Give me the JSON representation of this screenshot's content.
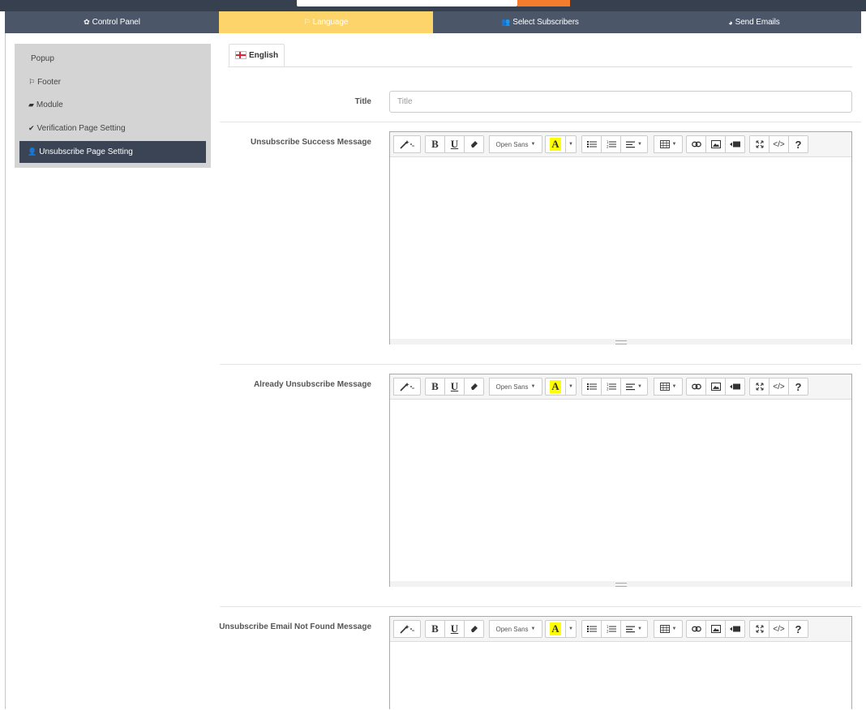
{
  "nav": {
    "tabs": [
      {
        "label": "Control Panel",
        "icon": "gear-icon",
        "glyph": "✿"
      },
      {
        "label": "Language",
        "icon": "language-icon",
        "glyph": "⚐"
      },
      {
        "label": "Select Subscribers",
        "icon": "users-icon",
        "glyph": "👥"
      },
      {
        "label": "Send Emails",
        "icon": "dashboard-icon",
        "glyph": "◕"
      }
    ],
    "active_tab": "Language",
    "active_color": "#fcd46a"
  },
  "sidebar": {
    "items": [
      {
        "label": "Popup",
        "icon": "",
        "glyph": ""
      },
      {
        "label": "Footer",
        "icon": "flag-icon",
        "glyph": "⚐"
      },
      {
        "label": "Module",
        "icon": "folder-icon",
        "glyph": "▰"
      },
      {
        "label": "Verification Page Setting",
        "icon": "check-icon",
        "glyph": "✔"
      },
      {
        "label": "Unsubscribe Page Setting",
        "icon": "user-remove-icon",
        "glyph": "👤"
      }
    ],
    "active_item": "Unsubscribe Page Setting"
  },
  "language_tab": {
    "label": "English",
    "icon": "uk-flag-icon"
  },
  "form": {
    "title_label": "Title",
    "title_placeholder": "Title",
    "title_value": "",
    "editors": [
      {
        "label": "Unsubscribe Success Message",
        "content": ""
      },
      {
        "label": "Already Unsubscribe Message",
        "content": ""
      },
      {
        "label": "Unsubscribe Email Not Found Message",
        "content": ""
      }
    ]
  },
  "toolbar": {
    "font_name": "Open Sans",
    "bold": "B",
    "underline": "U",
    "font_color": "A",
    "help": "?",
    "code": "</>",
    "icons": [
      "magic-icon",
      "bold-icon",
      "underline-icon",
      "eraser-icon",
      "font-family-dropdown",
      "font-color-icon",
      "color-dropdown-icon",
      "unordered-list-icon",
      "ordered-list-icon",
      "align-dropdown-icon",
      "table-icon",
      "link-icon",
      "image-icon",
      "video-icon",
      "fullscreen-icon",
      "code-view-icon",
      "help-icon"
    ]
  }
}
